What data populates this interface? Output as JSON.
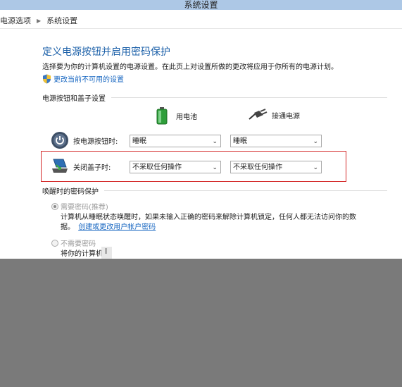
{
  "window": {
    "title": "系统设置"
  },
  "breadcrumb": [
    "电源选项",
    "系统设置"
  ],
  "heading": "定义电源按钮并启用密码保护",
  "description": "选择要为你的计算机设置的电源设置。在此页上对设置所做的更改将应用于你所有的电源计划。",
  "change_link": "更改当前不可用的设置",
  "power_section": {
    "title": "电源按钮和盖子设置",
    "battery_label": "用电池",
    "ac_label": "接通电源",
    "power_button": {
      "label": "按电源按钮时:",
      "battery_value": "睡眠",
      "ac_value": "睡眠"
    },
    "lid": {
      "label": "关闭盖子时:",
      "battery_value": "不采取任何操作",
      "ac_value": "不采取任何操作"
    }
  },
  "password_section": {
    "title": "唤醒时的密码保护",
    "option1_label": "需要密码(推荐)",
    "option1_desc": "计算机从睡眠状态唤醒时，如果未输入正确的密码来解除计算机锁定，任何人都无法访问你的数",
    "option1_desc2": "据。",
    "option1_link": "创建或更改用户帐户密码",
    "option2_label": "不需要密码",
    "option2_desc": "将你的计算机"
  }
}
